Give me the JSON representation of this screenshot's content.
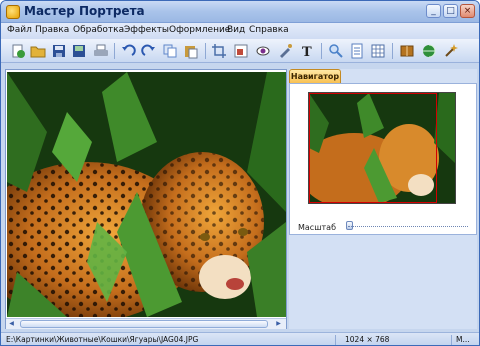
{
  "window": {
    "title": "Мастер Портрета"
  },
  "menu": [
    "Файл",
    "Правка",
    "Обработка",
    "Эффекты",
    "Оформление",
    "Вид",
    "Справка"
  ],
  "toolbar": {
    "buttons": [
      {
        "icon": "new-file-icon",
        "color": "#3a9b3a"
      },
      {
        "icon": "open-folder-icon",
        "color": "#e2b23a"
      },
      {
        "icon": "save-icon",
        "color": "#2c4f95"
      },
      {
        "icon": "save-as-icon",
        "color": "#2c4f95"
      },
      {
        "icon": "print-icon",
        "color": "#6d7a8f"
      },
      {
        "icon": "undo-icon",
        "color": "#2b58b0"
      },
      {
        "icon": "redo-icon",
        "color": "#2b58b0"
      },
      {
        "icon": "copy-icon",
        "color": "#5f86c9"
      },
      {
        "icon": "paste-icon",
        "color": "#c89a3c"
      },
      {
        "icon": "crop-icon",
        "color": "#4a6ea8"
      },
      {
        "icon": "resize-icon",
        "color": "#c04a3a"
      },
      {
        "icon": "red-eye-icon",
        "color": "#7a2e8c"
      },
      {
        "icon": "brush-icon",
        "color": "#5a6f94"
      },
      {
        "icon": "text-icon",
        "color": "#222222"
      },
      {
        "icon": "zoom-icon",
        "color": "#4c82c9"
      },
      {
        "icon": "page-icon",
        "color": "#5a7fbf"
      },
      {
        "icon": "grid-icon",
        "color": "#4e6ea6"
      },
      {
        "icon": "book-icon",
        "color": "#b5731f"
      },
      {
        "icon": "globe-icon",
        "color": "#2f8f3a"
      },
      {
        "icon": "wizard-icon",
        "color": "#d59a24"
      }
    ]
  },
  "navigator": {
    "tab_label": "Навигатор",
    "scale_label": "Масштаб"
  },
  "status": {
    "path": "E:\\Картинки\\Животные\\Кошки\\Ягуары\\JAG04.JPG",
    "dimensions": "1024 × 768",
    "extra": "M..."
  },
  "colors": {
    "accent": "#3c6ab8",
    "nav_tab": "#f8c052",
    "frame": "#d40000"
  }
}
